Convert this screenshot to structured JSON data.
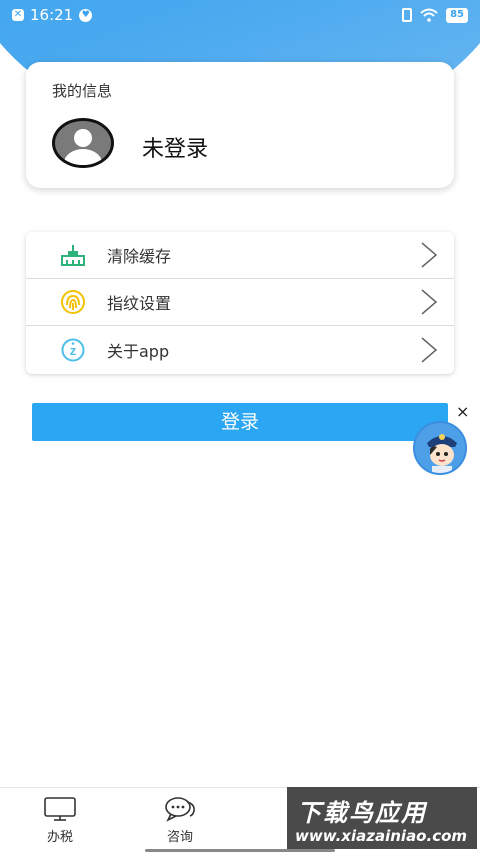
{
  "status_bar": {
    "time": "16:21",
    "battery": "85"
  },
  "profile": {
    "section_title": "我的信息",
    "login_status": "未登录"
  },
  "menu": {
    "items": [
      {
        "label": "清除缓存",
        "icon": "broom-icon"
      },
      {
        "label": "指纹设置",
        "icon": "fingerprint-icon"
      },
      {
        "label": "关于app",
        "icon": "about-icon"
      }
    ]
  },
  "login_button": {
    "label": "登录"
  },
  "float_widget": {
    "close": "×"
  },
  "bottom_nav": {
    "items": [
      {
        "label": "办税",
        "icon": "monitor-icon"
      },
      {
        "label": "咨询",
        "icon": "chat-icon"
      }
    ]
  },
  "watermark": {
    "title": "下载鸟应用",
    "url": "www.xiazainiao.com"
  },
  "colors": {
    "accent": "#2ba6f2",
    "header": "#3ba3ef",
    "broom": "#2db37a",
    "fingerprint": "#f2c200",
    "about": "#4cc0e8"
  }
}
